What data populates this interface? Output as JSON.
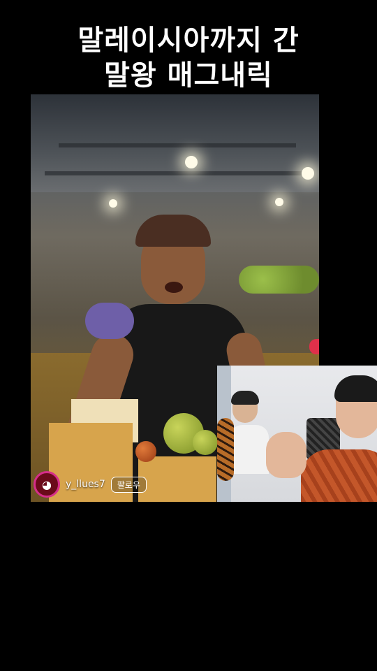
{
  "title": {
    "line1": "말레이시아까지 간",
    "line2": "말왕 매그내릭"
  },
  "live": {
    "username": "y_llues7",
    "follow_label": "팔로우",
    "avatar_icon": "duck-avatar-icon"
  },
  "colors": {
    "background": "#000000",
    "avatar_ring": "#d52e8a",
    "heart": "#e0304a"
  }
}
